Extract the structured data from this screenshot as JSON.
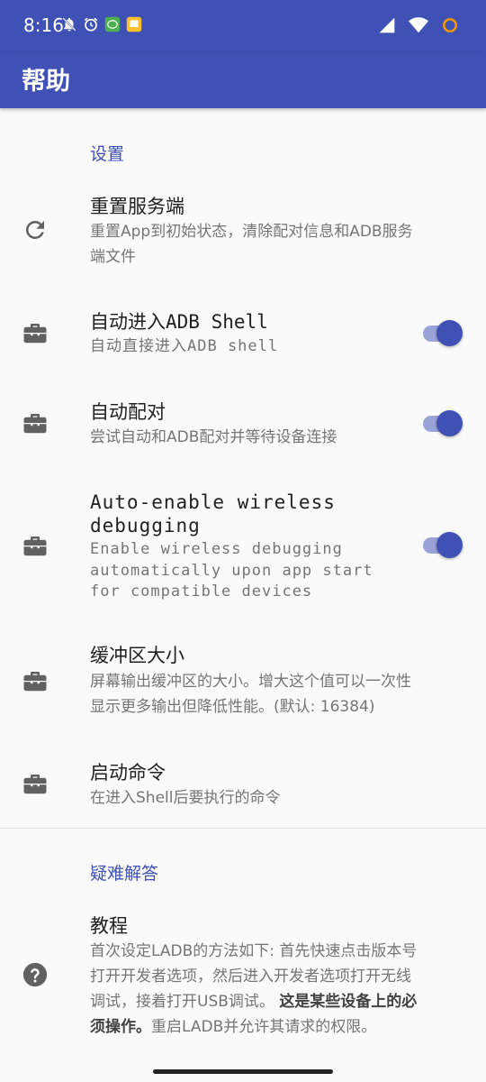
{
  "status_bar": {
    "time": "8:16"
  },
  "app_bar": {
    "title": "帮助"
  },
  "colors": {
    "primary": "#3f51b5",
    "toggle_track": "#9aa3d9"
  },
  "sections": {
    "settings": {
      "header": "设置",
      "reset_server": {
        "title": "重置服务端",
        "subtitle_line1": "重置App到初始状态，清除配对信息和ADB服务",
        "subtitle_line2": "端文件",
        "icon": "refresh-icon"
      },
      "auto_shell": {
        "title": "自动进入ADB Shell",
        "subtitle": "自动直接进入ADB shell",
        "enabled": true,
        "icon": "toolbox-icon"
      },
      "auto_pair": {
        "title": "自动配对",
        "subtitle": "尝试自动和ADB配对并等待设备连接",
        "enabled": true,
        "icon": "toolbox-icon"
      },
      "auto_wireless": {
        "title_line1": "Auto-enable wireless",
        "title_line2": "debugging",
        "subtitle_line1": "Enable wireless debugging",
        "subtitle_line2": "automatically upon app start",
        "subtitle_line3": "for compatible devices",
        "enabled": true,
        "icon": "toolbox-icon"
      },
      "buffer_size": {
        "title": "缓冲区大小",
        "subtitle_line1": "屏幕输出缓冲区的大小。增大这个值可以一次性",
        "subtitle_line2": "显示更多输出但降低性能。(默认: 16384)",
        "icon": "toolbox-icon"
      },
      "startup_command": {
        "title": "启动命令",
        "subtitle": "在进入Shell后要执行的命令",
        "icon": "toolbox-icon"
      }
    },
    "faq": {
      "header": "疑难解答",
      "tutorial": {
        "title": "教程",
        "line1": "首次设定LADB的方法如下: 首先快速点击版本号",
        "line2": "打开开发者选项，然后进入开发者选项打开无线",
        "line3_a": "调试，接着打开USB调试。",
        "line3_b": "这是某些设备上的必",
        "line4_a": "须操作。",
        "line4_b": "重启LADB并允许其请求的权限。",
        "icon": "help-circle-icon"
      }
    }
  }
}
